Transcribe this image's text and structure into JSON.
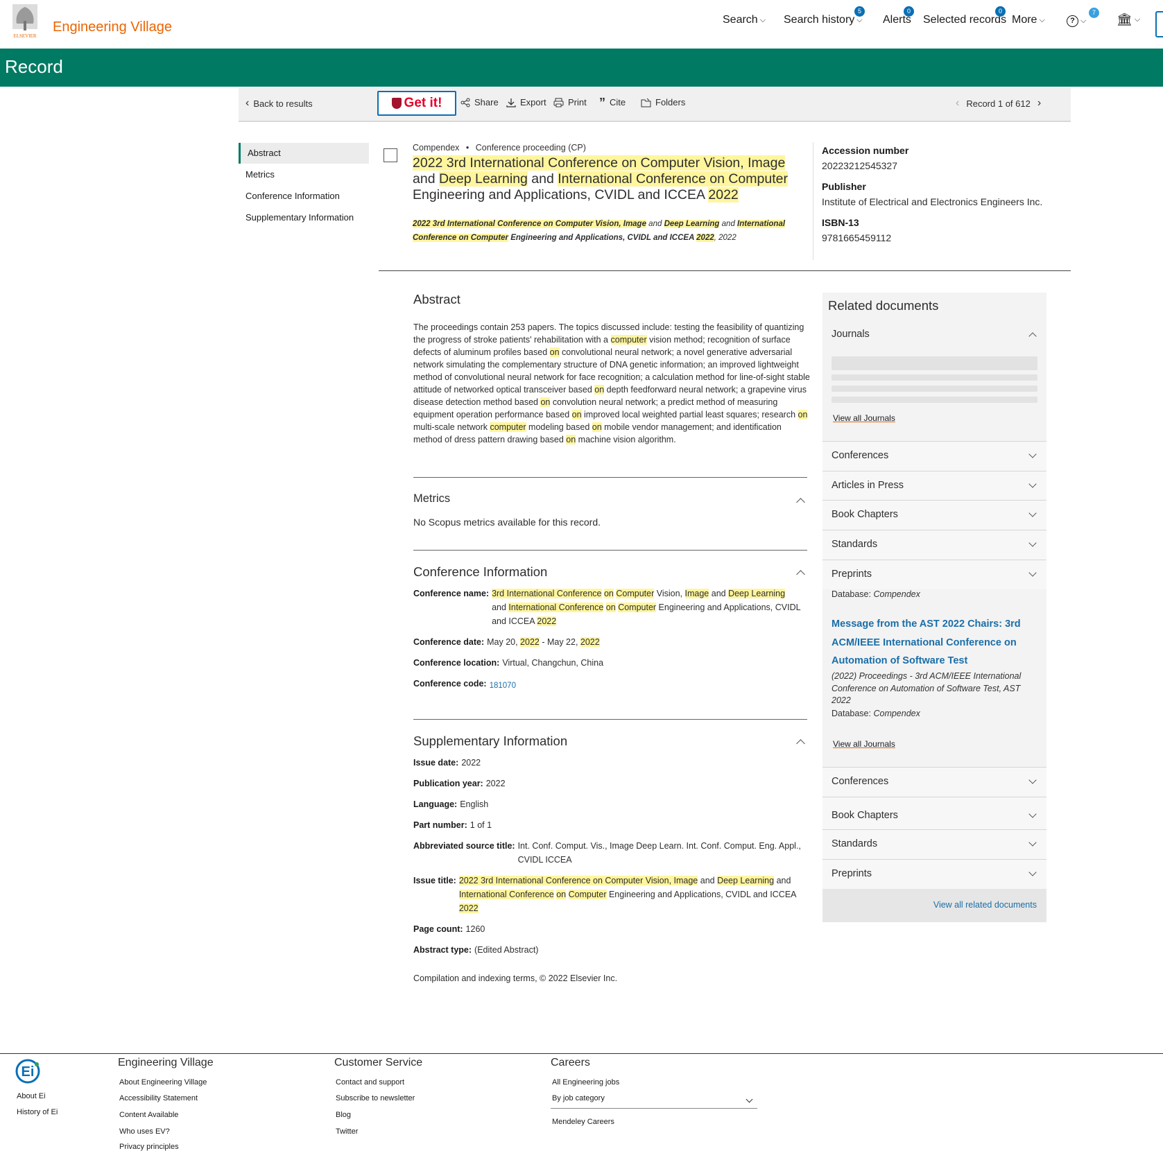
{
  "header": {
    "brand": "Engineering Village",
    "publisher_logo_text": "ELSEVIER",
    "nav": [
      {
        "label": "Search",
        "badge": ""
      },
      {
        "label": "Search history",
        "badge": "5"
      },
      {
        "label": "Alerts",
        "badge": "0"
      },
      {
        "label": "Selected records",
        "badge": "0"
      },
      {
        "label": "More",
        "badge": ""
      }
    ],
    "help_badge": "7"
  },
  "page_title": "Record",
  "toolbar": {
    "back": "Back to results",
    "getit": "Get it!",
    "share": "Share",
    "export": "Export",
    "print": "Print",
    "cite": "Cite",
    "folders": "Folders",
    "record_pos": "Record 1 of 612"
  },
  "left_nav": [
    "Abstract",
    "Metrics",
    "Conference Information",
    "Supplementary Information"
  ],
  "record": {
    "database": "Compendex",
    "doc_type": "Conference proceeding (CP)",
    "title": [
      {
        "t": "2022 3rd International Conference on Computer Vision, Image",
        "h": true
      },
      {
        "t": " and ",
        "h": false
      },
      {
        "t": "Deep Learning",
        "h": true
      },
      {
        "t": " and ",
        "h": false
      },
      {
        "t": "International Conference on Computer",
        "h": true
      },
      {
        "t": " Engineering and Applications, CVIDL and ICCEA ",
        "h": false
      },
      {
        "t": "2022",
        "h": true
      }
    ],
    "source": [
      {
        "t": "2022 3rd International Conference on Computer Vision, Image",
        "h": true,
        "b": true
      },
      {
        "t": " and ",
        "h": false,
        "b": false
      },
      {
        "t": "Deep Learning",
        "h": true,
        "b": true
      },
      {
        "t": " and ",
        "h": false,
        "b": false
      },
      {
        "t": "International Conference on Computer",
        "h": true,
        "b": true
      },
      {
        "t": " Engineering and Applications, CVIDL and ICCEA ",
        "h": false,
        "b": true
      },
      {
        "t": "2022",
        "h": true,
        "b": true
      },
      {
        "t": ", 2022",
        "h": false,
        "b": false
      }
    ],
    "accession_label": "Accession number",
    "accession": "20223212545327",
    "publisher_label": "Publisher",
    "publisher": "Institute of Electrical and Electronics Engineers Inc.",
    "isbn_label": "ISBN-13",
    "isbn": "9781665459112"
  },
  "abstract": {
    "heading": "Abstract",
    "text": [
      {
        "t": "The proceedings contain 253 papers. The topics discussed include: testing the feasibility of quantizing the progress of stroke patients' rehabilitation with a ",
        "h": false
      },
      {
        "t": "computer",
        "h": true
      },
      {
        "t": " vision method; recognition of surface defects of aluminum profiles based ",
        "h": false
      },
      {
        "t": "on",
        "h": true
      },
      {
        "t": " convolutional neural network; a novel generative adversarial network simulating the complementary structure of DNA genetic information; an improved lightweight method of convolutional neural network for face recognition; a calculation method for line-of-sight stable attitude of networked optical transceiver based ",
        "h": false
      },
      {
        "t": "on",
        "h": true
      },
      {
        "t": " depth feedforward neural network; a grapevine virus disease detection method based ",
        "h": false
      },
      {
        "t": "on",
        "h": true
      },
      {
        "t": " convolution neural network; a predict method of measuring equipment operation performance based ",
        "h": false
      },
      {
        "t": "on",
        "h": true
      },
      {
        "t": " improved local weighted partial least squares; research ",
        "h": false
      },
      {
        "t": "on",
        "h": true
      },
      {
        "t": " multi-scale network ",
        "h": false
      },
      {
        "t": "computer",
        "h": true
      },
      {
        "t": " modeling based ",
        "h": false
      },
      {
        "t": "on",
        "h": true
      },
      {
        "t": " mobile vendor management; and identification method of dress pattern drawing based ",
        "h": false
      },
      {
        "t": "on",
        "h": true
      },
      {
        "t": " machine vision algorithm.",
        "h": false
      }
    ]
  },
  "metrics": {
    "heading": "Metrics",
    "text": "No Scopus metrics available for this record."
  },
  "conference": {
    "heading": "Conference Information",
    "name_label": "Conference name:",
    "name": [
      {
        "t": "3rd International Conference",
        "h": true
      },
      {
        "t": " ",
        "h": false
      },
      {
        "t": "on",
        "h": true
      },
      {
        "t": " ",
        "h": false
      },
      {
        "t": "Computer",
        "h": true
      },
      {
        "t": " Vision, ",
        "h": false
      },
      {
        "t": "Image",
        "h": true
      },
      {
        "t": " and ",
        "h": false
      },
      {
        "t": "Deep Learning",
        "h": true
      },
      {
        "t": " and ",
        "h": false
      },
      {
        "t": "International Conference",
        "h": true
      },
      {
        "t": " ",
        "h": false
      },
      {
        "t": "on",
        "h": true
      },
      {
        "t": " ",
        "h": false
      },
      {
        "t": "Computer",
        "h": true
      },
      {
        "t": " Engineering and Applications, CVIDL and ICCEA ",
        "h": false
      },
      {
        "t": "2022",
        "h": true
      }
    ],
    "date_label": "Conference date:",
    "date": [
      {
        "t": "May 20, ",
        "h": false
      },
      {
        "t": "2022",
        "h": true
      },
      {
        "t": " - May 22, ",
        "h": false
      },
      {
        "t": "2022",
        "h": true
      }
    ],
    "location_label": "Conference location:",
    "location": "Virtual, Changchun, China",
    "code_label": "Conference code:",
    "code": "181070"
  },
  "supplementary": {
    "heading": "Supplementary Information",
    "issue_date_label": "Issue date:",
    "issue_date": "2022",
    "pub_year_label": "Publication year:",
    "pub_year": "2022",
    "language_label": "Language:",
    "language": "English",
    "part_label": "Part number:",
    "part": "1 of 1",
    "abbrev_label": "Abbreviated source title:",
    "abbrev": "Int. Conf. Comput. Vis., Image Deep Learn. Int. Conf. Comput. Eng. Appl., CVIDL ICCEA",
    "issue_title_label": "Issue title:",
    "issue_title": [
      {
        "t": "2022 3rd International Conference on Computer Vision, Image",
        "h": true
      },
      {
        "t": " and ",
        "h": false
      },
      {
        "t": "Deep Learning",
        "h": true
      },
      {
        "t": " and ",
        "h": false
      },
      {
        "t": "International Conference",
        "h": true
      },
      {
        "t": " ",
        "h": false
      },
      {
        "t": "on",
        "h": true
      },
      {
        "t": " ",
        "h": false
      },
      {
        "t": "Computer",
        "h": true
      },
      {
        "t": " Engineering and Applications, CVIDL and ICCEA ",
        "h": false
      },
      {
        "t": "2022",
        "h": true
      }
    ],
    "page_count_label": "Page count:",
    "page_count": "1260",
    "abstract_type_label": "Abstract type:",
    "abstract_type": "(Edited Abstract)",
    "copyright": "Compilation and indexing terms, © 2022 Elsevier Inc."
  },
  "related": {
    "heading": "Related documents",
    "journals": "Journals",
    "view_all_journals": "View all Journals",
    "sections_top": [
      "Conferences",
      "Articles in Press",
      "Book Chapters",
      "Standards",
      "Preprints"
    ],
    "overflow_db_label": "Database:",
    "overflow_db": "Compendex",
    "article_title": "Message from the AST 2022 Chairs: 3rd ACM/IEEE International Conference on Automation of Software Test",
    "article_source": "(2022) Proceedings - 3rd ACM/IEEE International Conference on Automation of Software Test, AST 2022",
    "article_db_label": "Database:",
    "article_db": "Compendex",
    "view_all_journals_2": "View all Journals",
    "sections_bottom": [
      "Conferences",
      "Book Chapters",
      "Standards",
      "Preprints"
    ],
    "view_all": "View all related documents"
  },
  "footer": {
    "ei_links": [
      "About Ei",
      "History of Ei"
    ],
    "col1_title": "Engineering Village",
    "col1": [
      "About Engineering Village",
      "Accessibility Statement",
      "Content Available",
      "Who uses EV?",
      "Privacy principles"
    ],
    "col2_title": "Customer Service",
    "col2": [
      "Contact and support",
      "Subscribe to newsletter",
      "Blog",
      "Twitter"
    ],
    "col3_title": "Careers",
    "col3": [
      "All Engineering jobs",
      "By job category",
      "Mendeley Careers"
    ]
  }
}
